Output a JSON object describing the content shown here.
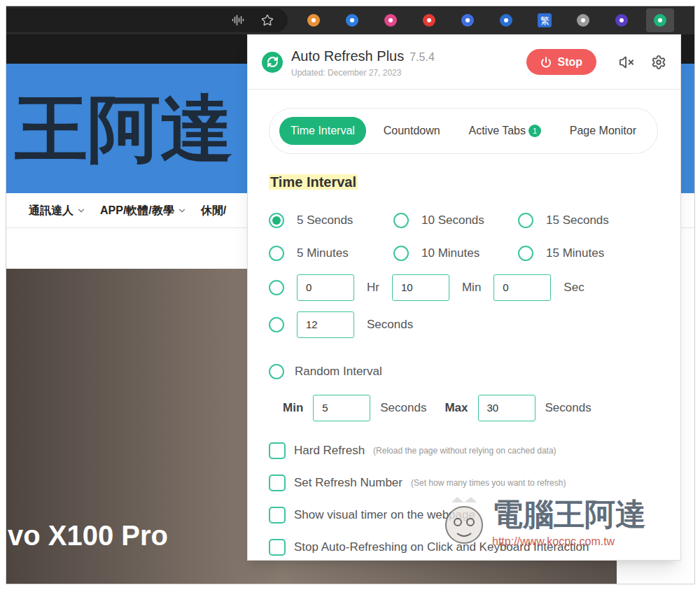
{
  "browser": {
    "extensions": [
      {
        "kind": "icon",
        "color": "#e8913a",
        "selected": false
      },
      {
        "kind": "icon",
        "color": "#2f7de1",
        "selected": false
      },
      {
        "kind": "icon",
        "color": "#e2478a",
        "selected": false
      },
      {
        "kind": "icon",
        "color": "#e53935",
        "selected": false
      },
      {
        "kind": "icon",
        "color": "#3f6fe0",
        "selected": false
      },
      {
        "kind": "icon",
        "color": "#2a6fd0",
        "selected": false
      },
      {
        "kind": "glyph",
        "label": "繁",
        "color": "#2f6fd6",
        "selected": false
      },
      {
        "kind": "icon",
        "color": "#9a9a9a",
        "selected": false
      },
      {
        "kind": "icon",
        "color": "#5b3cc4",
        "selected": false
      },
      {
        "kind": "icon",
        "color": "#1db57a",
        "selected": true
      }
    ]
  },
  "website": {
    "logo": "王阿達",
    "nav": [
      {
        "label": "通訊達人",
        "dropdown": true
      },
      {
        "label": "APP/軟體/教學",
        "dropdown": true
      },
      {
        "label": "休閒/",
        "dropdown": false
      }
    ],
    "headline": "vo X100 Pro"
  },
  "popup": {
    "title": "Auto Refresh Plus",
    "version": "7.5.4",
    "updated": "Updated: December 27, 2023",
    "stop_button": "Stop",
    "sound_muted": true,
    "tabs": [
      {
        "label": "Time Interval",
        "selected": true
      },
      {
        "label": "Countdown",
        "selected": false
      },
      {
        "label": "Active Tabs",
        "badge": "1",
        "selected": false
      },
      {
        "label": "Page Monitor",
        "selected": false
      }
    ],
    "section_title": "Time Interval",
    "intervals": [
      {
        "kind": "preset",
        "label": "5 Seconds",
        "selected": true
      },
      {
        "kind": "preset",
        "label": "10 Seconds",
        "selected": false
      },
      {
        "kind": "preset",
        "label": "15 Seconds",
        "selected": false
      },
      {
        "kind": "preset",
        "label": "5 Minutes",
        "selected": false
      },
      {
        "kind": "preset",
        "label": "10 Minutes",
        "selected": false
      },
      {
        "kind": "preset",
        "label": "15 Minutes",
        "selected": false
      },
      {
        "kind": "hms",
        "fields": [
          {
            "value": "0",
            "unit": "Hr"
          },
          {
            "value": "10",
            "unit": "Min"
          },
          {
            "value": "0",
            "unit": "Sec"
          }
        ],
        "selected": false
      },
      {
        "kind": "seconds",
        "value": "12",
        "unit": "Seconds",
        "selected": false
      },
      {
        "kind": "random",
        "label": "Random Interval",
        "selected": false
      }
    ],
    "random_range": {
      "min_label": "Min",
      "min": "5",
      "min_unit": "Seconds",
      "max_label": "Max",
      "max": "30",
      "max_unit": "Seconds"
    },
    "options": [
      {
        "label": "Hard Refresh",
        "note": "(Reload the page without relying on cached data)",
        "checked": false
      },
      {
        "label": "Set Refresh Number",
        "note": "(Set how many times you want to refresh)",
        "checked": false
      },
      {
        "label": "Show visual timer on the webpage",
        "checked": false
      },
      {
        "label": "Stop Auto-Refreshing on Click and Keyboard Interaction",
        "checked": false
      }
    ]
  },
  "watermark": {
    "title": "電腦王阿達",
    "url": "http://www.kocpc.com.tw"
  }
}
